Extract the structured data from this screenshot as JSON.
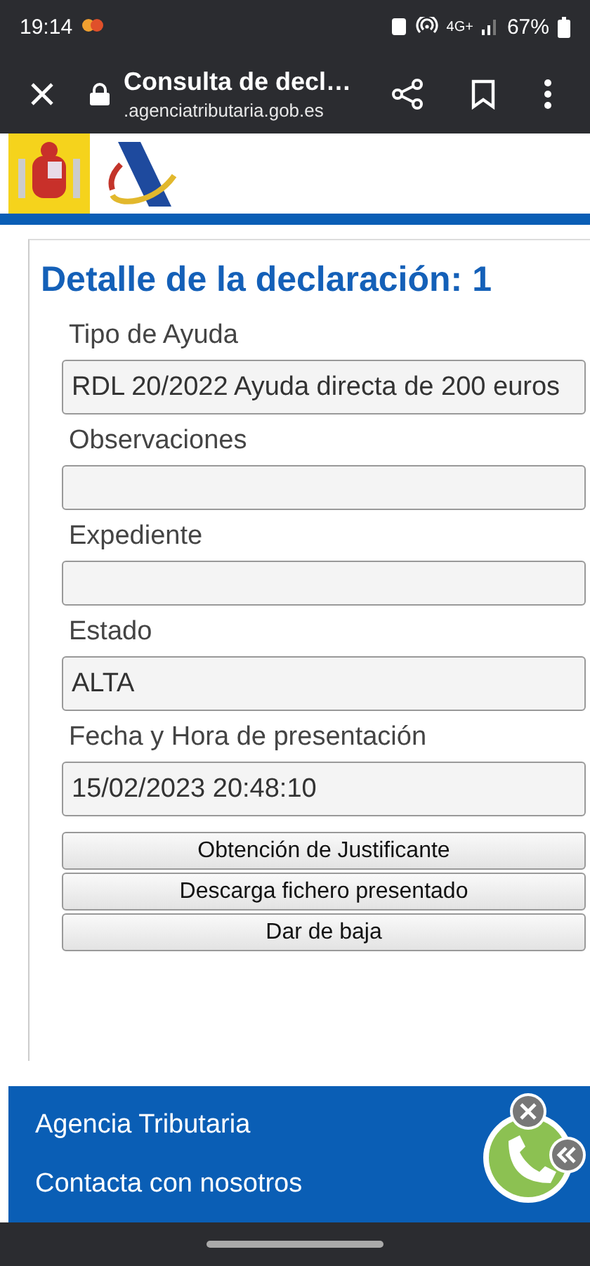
{
  "status_bar": {
    "time": "19:14",
    "network": "4G+",
    "battery": "67%"
  },
  "browser": {
    "title": "Consulta de decl…",
    "url": ".agenciatributaria.gob.es"
  },
  "page": {
    "heading": "Detalle de la declaración: 1",
    "fields": [
      {
        "label": "Tipo de Ayuda",
        "value": "RDL 20/2022 Ayuda directa de 200 euros"
      },
      {
        "label": "Observaciones"
      },
      {
        "label": "Expediente"
      },
      {
        "label": "Estado",
        "value": "ALTA"
      },
      {
        "label": "Fecha y Hora de presentación",
        "value": "15/02/2023 20:48:10"
      }
    ],
    "buttons": [
      "Obtención de Justificante",
      "Descarga fichero presentado",
      "Dar de baja"
    ]
  },
  "footer": {
    "links": [
      "Agencia Tributaria",
      "Contacta con nosotros"
    ]
  }
}
